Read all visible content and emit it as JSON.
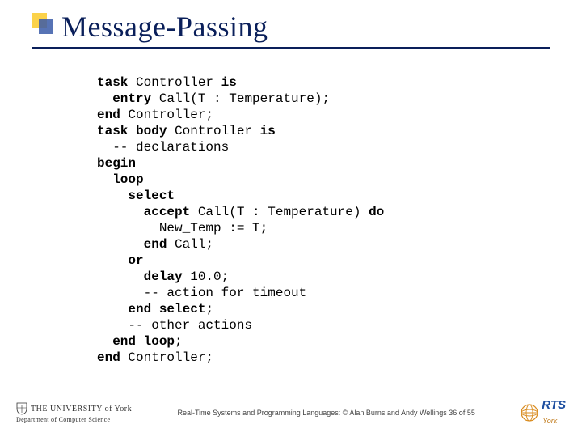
{
  "title": "Message-Passing",
  "code": {
    "l1a": "task",
    "l1b": " Controller ",
    "l1c": "is",
    "l2a": "  entry",
    "l2b": " Call(T : Temperature);",
    "l3a": "end",
    "l3b": " Controller;",
    "l4a": "task body",
    "l4b": " Controller ",
    "l4c": "is",
    "l5": "  -- declarations",
    "l6": "begin",
    "l7": "  loop",
    "l8": "    select",
    "l9a": "      accept",
    "l9b": " Call(T : Temperature) ",
    "l9c": "do",
    "l10": "        New_Temp := T;",
    "l11a": "      end",
    "l11b": " Call;",
    "l12": "    or",
    "l13a": "      delay",
    "l13b": " 10.0;",
    "l14": "      -- action for timeout",
    "l15a": "    end",
    "l15b": " ",
    "l15c": "select",
    "l15d": ";",
    "l16": "    -- other actions",
    "l17a": "  end",
    "l17b": " ",
    "l17c": "loop",
    "l17d": ";",
    "l18a": "end",
    "l18b": " Controller;"
  },
  "footer": {
    "uni_name": "THE UNIVERSITY of York",
    "uni_dept": "Department of Computer Science",
    "text": "Real-Time Systems and Programming Languages: © Alan Burns and Andy Wellings  36 of 55",
    "rts": "RTS",
    "rts_sub": "York"
  }
}
